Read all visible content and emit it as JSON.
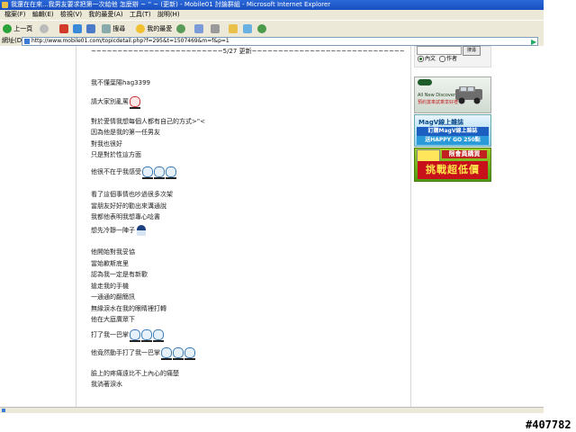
{
  "window": {
    "title": "我還在在來...我男友要求把第一次給他 怎麼辦 ~ '' ~ (更新) - Mobile01 討論群組 - Microsoft Internet Explorer"
  },
  "menubar": [
    "檔案(F)",
    "編輯(E)",
    "檢視(V)",
    "我的最愛(A)",
    "工具(T)",
    "說明(H)"
  ],
  "toolbar": {
    "back": "上一頁",
    "search": "搜尋",
    "favorites": "我的最愛"
  },
  "address": {
    "label": "網址(D)",
    "url": "http://www.mobile01.com/topicdetail.php?f=295&t=1507469&m=f&p=1"
  },
  "post": {
    "update_line": "~~~~~~~~~~~~~~~~~~~~~~~~~5/27 更新~~~~~~~~~~~~~~~~~~~~~~~~~~~~~",
    "lines": [
      "我不懂葉陽hag3399",
      "請大家別亂罵",
      "對於愛情我想每個人都有自己的方式>\"<",
      "因為他是我的第一任男友",
      "對我也很好",
      "只是對於性這方面",
      "他很不在乎我感受",
      "看了這個事情也吵過很多次架",
      "當朋友好好的勸出來溝通說",
      "我都他表明我想專心唸書",
      "想先冷靜一陣子",
      "他開始對我妥協",
      "當始歉斯底里",
      "認為我一定是有新歡",
      "搶走我的手機",
      "一通通的翻簡訊",
      "無緣淚水在我的眼睛裡打轉",
      "他在大庭廣眾下",
      "打了我一巴掌",
      "他竟然動手打了我一巴掌",
      "臉上的疼痛遠比不上內心的痛楚",
      "我淌著淚水"
    ]
  },
  "sidebar": {
    "search_button": "搜尋",
    "radio_content": "內文",
    "radio_author": "作者",
    "ad1": {
      "line1": "All New Discovery 4",
      "line2": "預約賞車試乘享好禮"
    },
    "ad2": {
      "brand": "MagV線上雜誌",
      "line1": "訂購MagV線上雜誌",
      "line2": "送HAPPY GO 250點"
    },
    "ad3": {
      "badge": "限會員購買",
      "headline": "挑戰超低價"
    }
  },
  "watermark": "#407782"
}
